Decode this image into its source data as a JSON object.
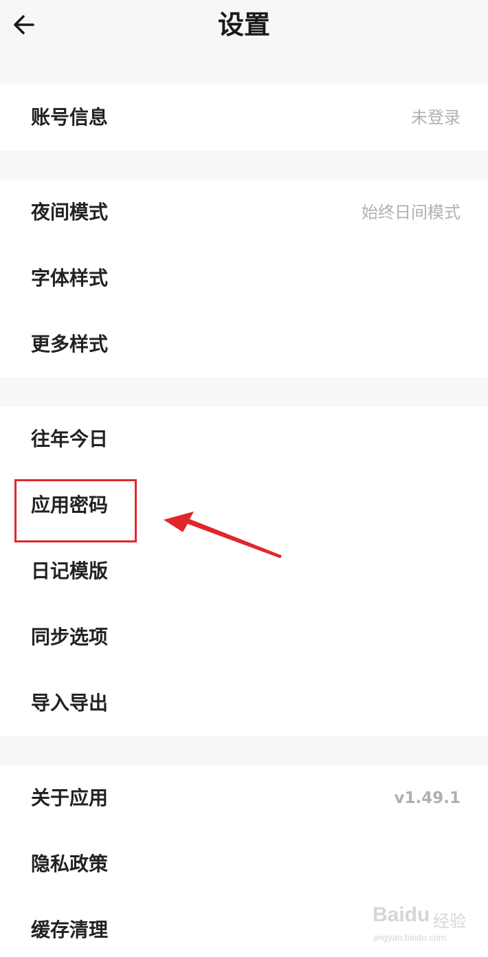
{
  "header": {
    "title": "设置",
    "back_icon": "back-arrow-icon"
  },
  "groups": [
    {
      "items": [
        {
          "label": "账号信息",
          "value": "未登录"
        }
      ]
    },
    {
      "items": [
        {
          "label": "夜间模式",
          "value": "始终日间模式"
        },
        {
          "label": "字体样式",
          "value": ""
        },
        {
          "label": "更多样式",
          "value": ""
        }
      ]
    },
    {
      "items": [
        {
          "label": "往年今日",
          "value": ""
        },
        {
          "label": "应用密码",
          "value": ""
        },
        {
          "label": "日记模版",
          "value": ""
        },
        {
          "label": "同步选项",
          "value": ""
        },
        {
          "label": "导入导出",
          "value": ""
        }
      ]
    },
    {
      "items": [
        {
          "label": "关于应用",
          "value": "v1.49.1"
        },
        {
          "label": "隐私政策",
          "value": ""
        },
        {
          "label": "缓存清理",
          "value": ""
        }
      ]
    }
  ],
  "annotation": {
    "color": "#e0262b",
    "highlighted_item": "应用密码"
  },
  "watermark": {
    "logo": "Baidu",
    "cn": "经验",
    "url": "jingyan.baidu.com"
  },
  "colors": {
    "background": "#f7f7f7",
    "card": "#ffffff",
    "label": "#222222",
    "value": "#b0b0b0"
  }
}
